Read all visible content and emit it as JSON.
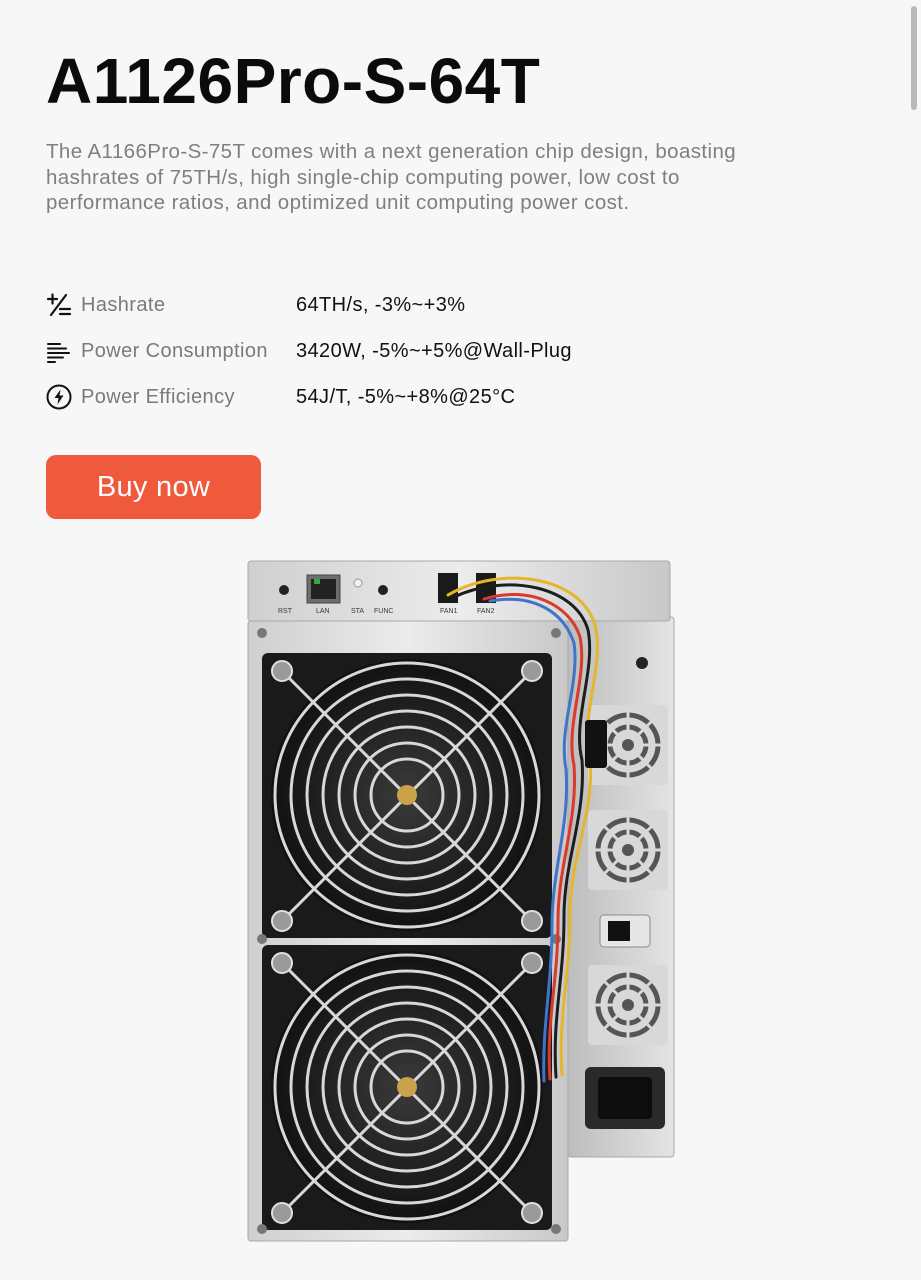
{
  "product": {
    "title": "A1126Pro-S-64T",
    "description": "The A1166Pro-S-75T comes with a next generation chip design, boasting hashrates of 75TH/s, high single-chip computing power, low cost to performance ratios, and optimized unit computing power cost."
  },
  "specs": [
    {
      "icon": "plus-minus-icon",
      "label": "Hashrate",
      "value": "64TH/s, -3%~+3%"
    },
    {
      "icon": "text-lines-icon",
      "label": "Power Consumption",
      "value": "3420W, -5%~+5%@Wall-Plug"
    },
    {
      "icon": "lightning-circle-icon",
      "label": "Power Efficiency",
      "value": "54J/T, -5%~+8%@25°C"
    }
  ],
  "buy_button": {
    "label": "Buy now"
  },
  "device_ports": {
    "rst": "RST",
    "lan": "LAN",
    "sta": "STA",
    "func": "FUNC",
    "fan1": "FAN1",
    "fan2": "FAN2"
  },
  "colors": {
    "accent": "#f05a3c",
    "background": "#f7f7f7",
    "title": "#0b0b0b",
    "muted_text": "#7f7f7f"
  }
}
